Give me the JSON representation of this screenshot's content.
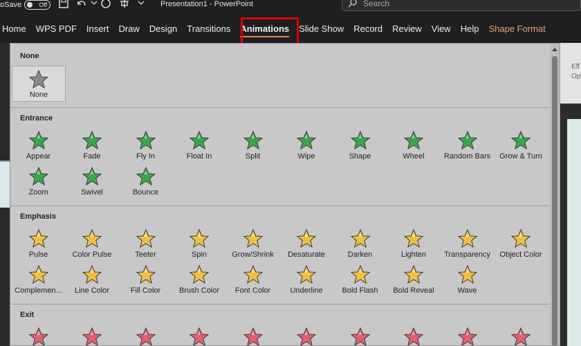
{
  "titlebar": {
    "autosave_label": "oSave",
    "toggle_state": "Off",
    "doc_title": "Presentation1  -  PowerPoint",
    "search_placeholder": "Search"
  },
  "tabs": [
    {
      "name": "tab-home",
      "label": "Home"
    },
    {
      "name": "tab-wps-pdf",
      "label": "WPS PDF"
    },
    {
      "name": "tab-insert",
      "label": "Insert"
    },
    {
      "name": "tab-draw",
      "label": "Draw"
    },
    {
      "name": "tab-design",
      "label": "Design"
    },
    {
      "name": "tab-transitions",
      "label": "Transitions"
    },
    {
      "name": "tab-animations",
      "label": "Animations",
      "active": true
    },
    {
      "name": "tab-slide-show",
      "label": "Slide Show"
    },
    {
      "name": "tab-record",
      "label": "Record"
    },
    {
      "name": "tab-review",
      "label": "Review"
    },
    {
      "name": "tab-view",
      "label": "View"
    },
    {
      "name": "tab-help",
      "label": "Help"
    },
    {
      "name": "tab-shape-format",
      "label": "Shape Format",
      "contextual": true
    }
  ],
  "ribbon_right": {
    "effect_options_line1": "Eff",
    "effect_options_line2": "Opti"
  },
  "gallery": {
    "none_section": {
      "title": "None",
      "item": {
        "label": "None"
      }
    },
    "entrance": {
      "title": "Entrance",
      "color": "#3aa84a",
      "items": [
        "Appear",
        "Fade",
        "Fly In",
        "Float In",
        "Split",
        "Wipe",
        "Shape",
        "Wheel",
        "Random Bars",
        "Grow & Turn",
        "Zoom",
        "Swivel",
        "Bounce"
      ]
    },
    "emphasis": {
      "title": "Emphasis",
      "color": "#f0c040",
      "items": [
        "Pulse",
        "Color Pulse",
        "Teeter",
        "Spin",
        "Grow/Shrink",
        "Desaturate",
        "Darken",
        "Lighten",
        "Transparency",
        "Object Color",
        "Complemen...",
        "Line Color",
        "Fill Color",
        "Brush Color",
        "Font Color",
        "Underline",
        "Bold Flash",
        "Bold Reveal",
        "Wave"
      ]
    },
    "exit": {
      "title": "Exit",
      "color": "#e06070",
      "item_count": 10
    }
  }
}
